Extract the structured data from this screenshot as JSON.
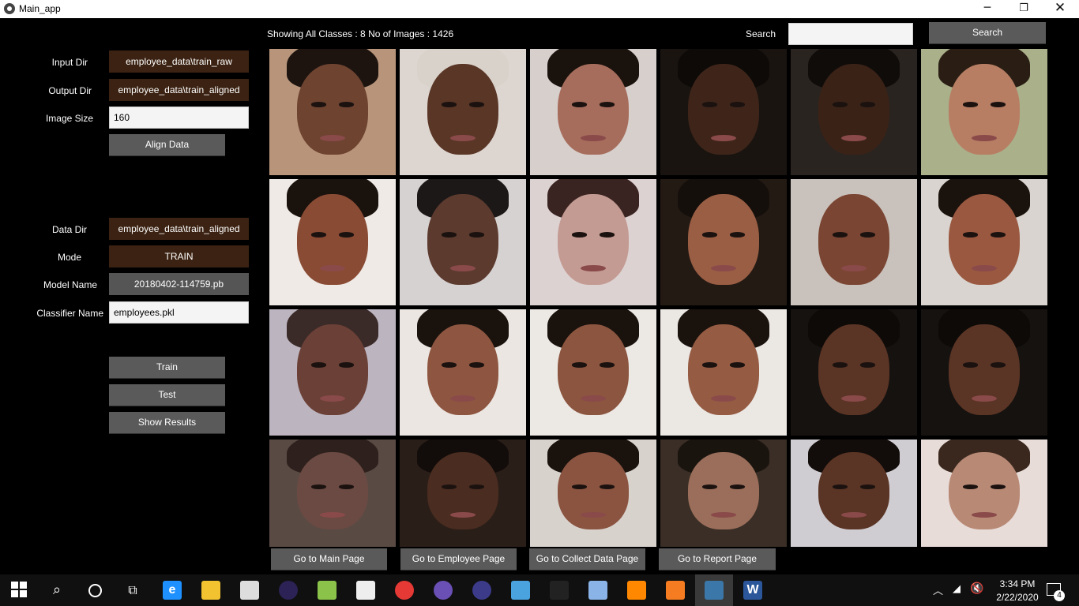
{
  "window": {
    "title": "Main_app",
    "minimize_glyph": "─",
    "maximize_glyph": "❐",
    "close_glyph": "✕"
  },
  "header": {
    "info": "Showing All Classes : 8 No of Images : 1426",
    "search_label": "Search",
    "search_value": "",
    "search_button": "Search"
  },
  "align_section": {
    "input_dir_label": "Input Dir",
    "input_dir_value": "employee_data\\train_raw",
    "output_dir_label": "Output Dir",
    "output_dir_value": "employee_data\\train_aligned",
    "image_size_label": "Image Size",
    "image_size_value": "160",
    "align_button": "Align Data"
  },
  "train_section": {
    "data_dir_label": "Data Dir",
    "data_dir_value": "employee_data\\train_aligned",
    "mode_label": "Mode",
    "mode_value": "TRAIN",
    "model_name_label": "Model Name",
    "model_name_value": "20180402-114759.pb",
    "classifier_label": "Classifier Name",
    "classifier_value": "employees.pkl",
    "train_button": "Train",
    "test_button": "Test",
    "show_results_button": "Show Results"
  },
  "nav": {
    "main": "Go to Main Page",
    "employee": "Go to Employee Page",
    "collect": "Go to Collect Data Page",
    "report": "Go to Report Page"
  },
  "image_grid": {
    "rows": 4,
    "cols": 6,
    "tiles": [
      {
        "bg": "#b8957a",
        "skin": "#6e4330",
        "hair": "#1d1410"
      },
      {
        "bg": "#ddd6d0",
        "skin": "#5a3626",
        "hair": "#d9d2ca"
      },
      {
        "bg": "#d6cfcc",
        "skin": "#a76d5c",
        "hair": "#1a120d"
      },
      {
        "bg": "#1a1410",
        "skin": "#3f2519",
        "hair": "#0e0a08"
      },
      {
        "bg": "#2a2420",
        "skin": "#3a2217",
        "hair": "#100c0a"
      },
      {
        "bg": "#a9b08a",
        "skin": "#b77e64",
        "hair": "#2a1e14"
      },
      {
        "bg": "#efeae6",
        "skin": "#8a4b34",
        "hair": "#1a120d"
      },
      {
        "bg": "#d6d2d2",
        "skin": "#5c3a2e",
        "hair": "#1c1818"
      },
      {
        "bg": "#ddd2d2",
        "skin": "#c39b92",
        "hair": "#3a2422"
      },
      {
        "bg": "#241a14",
        "skin": "#9a5e44",
        "hair": "#150f0b"
      },
      {
        "bg": "#c9c1bb",
        "skin": "#7a4532",
        "hair": "#c9c1bb"
      },
      {
        "bg": "#d9d4cf",
        "skin": "#9a5840",
        "hair": "#1a120d"
      },
      {
        "bg": "#bcb5c0",
        "skin": "#6b4036",
        "hair": "#3a2a28"
      },
      {
        "bg": "#ebe6e2",
        "skin": "#8e5640",
        "hair": "#1a120d"
      },
      {
        "bg": "#ece8e4",
        "skin": "#8c553f",
        "hair": "#1a120d"
      },
      {
        "bg": "#ebe7e3",
        "skin": "#955b43",
        "hair": "#1a120d"
      },
      {
        "bg": "#161210",
        "skin": "#5a3424",
        "hair": "#0e0a08"
      },
      {
        "bg": "#161210",
        "skin": "#5a3424",
        "hair": "#0e0a08"
      },
      {
        "bg": "#5a4a44",
        "skin": "#6a4a42",
        "hair": "#2e201c"
      },
      {
        "bg": "#2a1e18",
        "skin": "#4a2c20",
        "hair": "#120c0a"
      },
      {
        "bg": "#d8d2cd",
        "skin": "#8a5440",
        "hair": "#1a120d"
      },
      {
        "bg": "#3a2e26",
        "skin": "#9a6e5a",
        "hair": "#1a140f"
      },
      {
        "bg": "#d0cdd2",
        "skin": "#5a3424",
        "hair": "#120c0a"
      },
      {
        "bg": "#e8dcd8",
        "skin": "#b88a76",
        "hair": "#3a281e"
      }
    ]
  },
  "taskbar": {
    "time": "3:34 PM",
    "date": "2/22/2020",
    "notification_count": "4",
    "apps": [
      {
        "name": "ie-icon",
        "color": "#1e90ff",
        "glyph": "e"
      },
      {
        "name": "file-explorer-icon",
        "color": "#f2c230",
        "glyph": ""
      },
      {
        "name": "store-icon",
        "color": "#dddddd",
        "glyph": ""
      },
      {
        "name": "eclipse-icon",
        "color": "#2c2255",
        "glyph": ""
      },
      {
        "name": "notepadpp-icon",
        "color": "#8bc34a",
        "glyph": ""
      },
      {
        "name": "mail-icon",
        "color": "#eeeeee",
        "glyph": ""
      },
      {
        "name": "chrome-icon",
        "color": "#e53935",
        "glyph": ""
      },
      {
        "name": "anaconda-icon",
        "color": "#6a4fb5",
        "glyph": ""
      },
      {
        "name": "eclipse2-icon",
        "color": "#3b3b8a",
        "glyph": ""
      },
      {
        "name": "control-panel-icon",
        "color": "#4aa3df",
        "glyph": ""
      },
      {
        "name": "terminal-icon",
        "color": "#222222",
        "glyph": ""
      },
      {
        "name": "virtualbox-icon",
        "color": "#8ab4e8",
        "glyph": ""
      },
      {
        "name": "vlc-icon",
        "color": "#ff8800",
        "glyph": ""
      },
      {
        "name": "xampp-icon",
        "color": "#f57c20",
        "glyph": ""
      },
      {
        "name": "python-icon",
        "color": "#3b77a8",
        "glyph": ""
      },
      {
        "name": "word-icon",
        "color": "#2b579a",
        "glyph": "W"
      }
    ]
  }
}
